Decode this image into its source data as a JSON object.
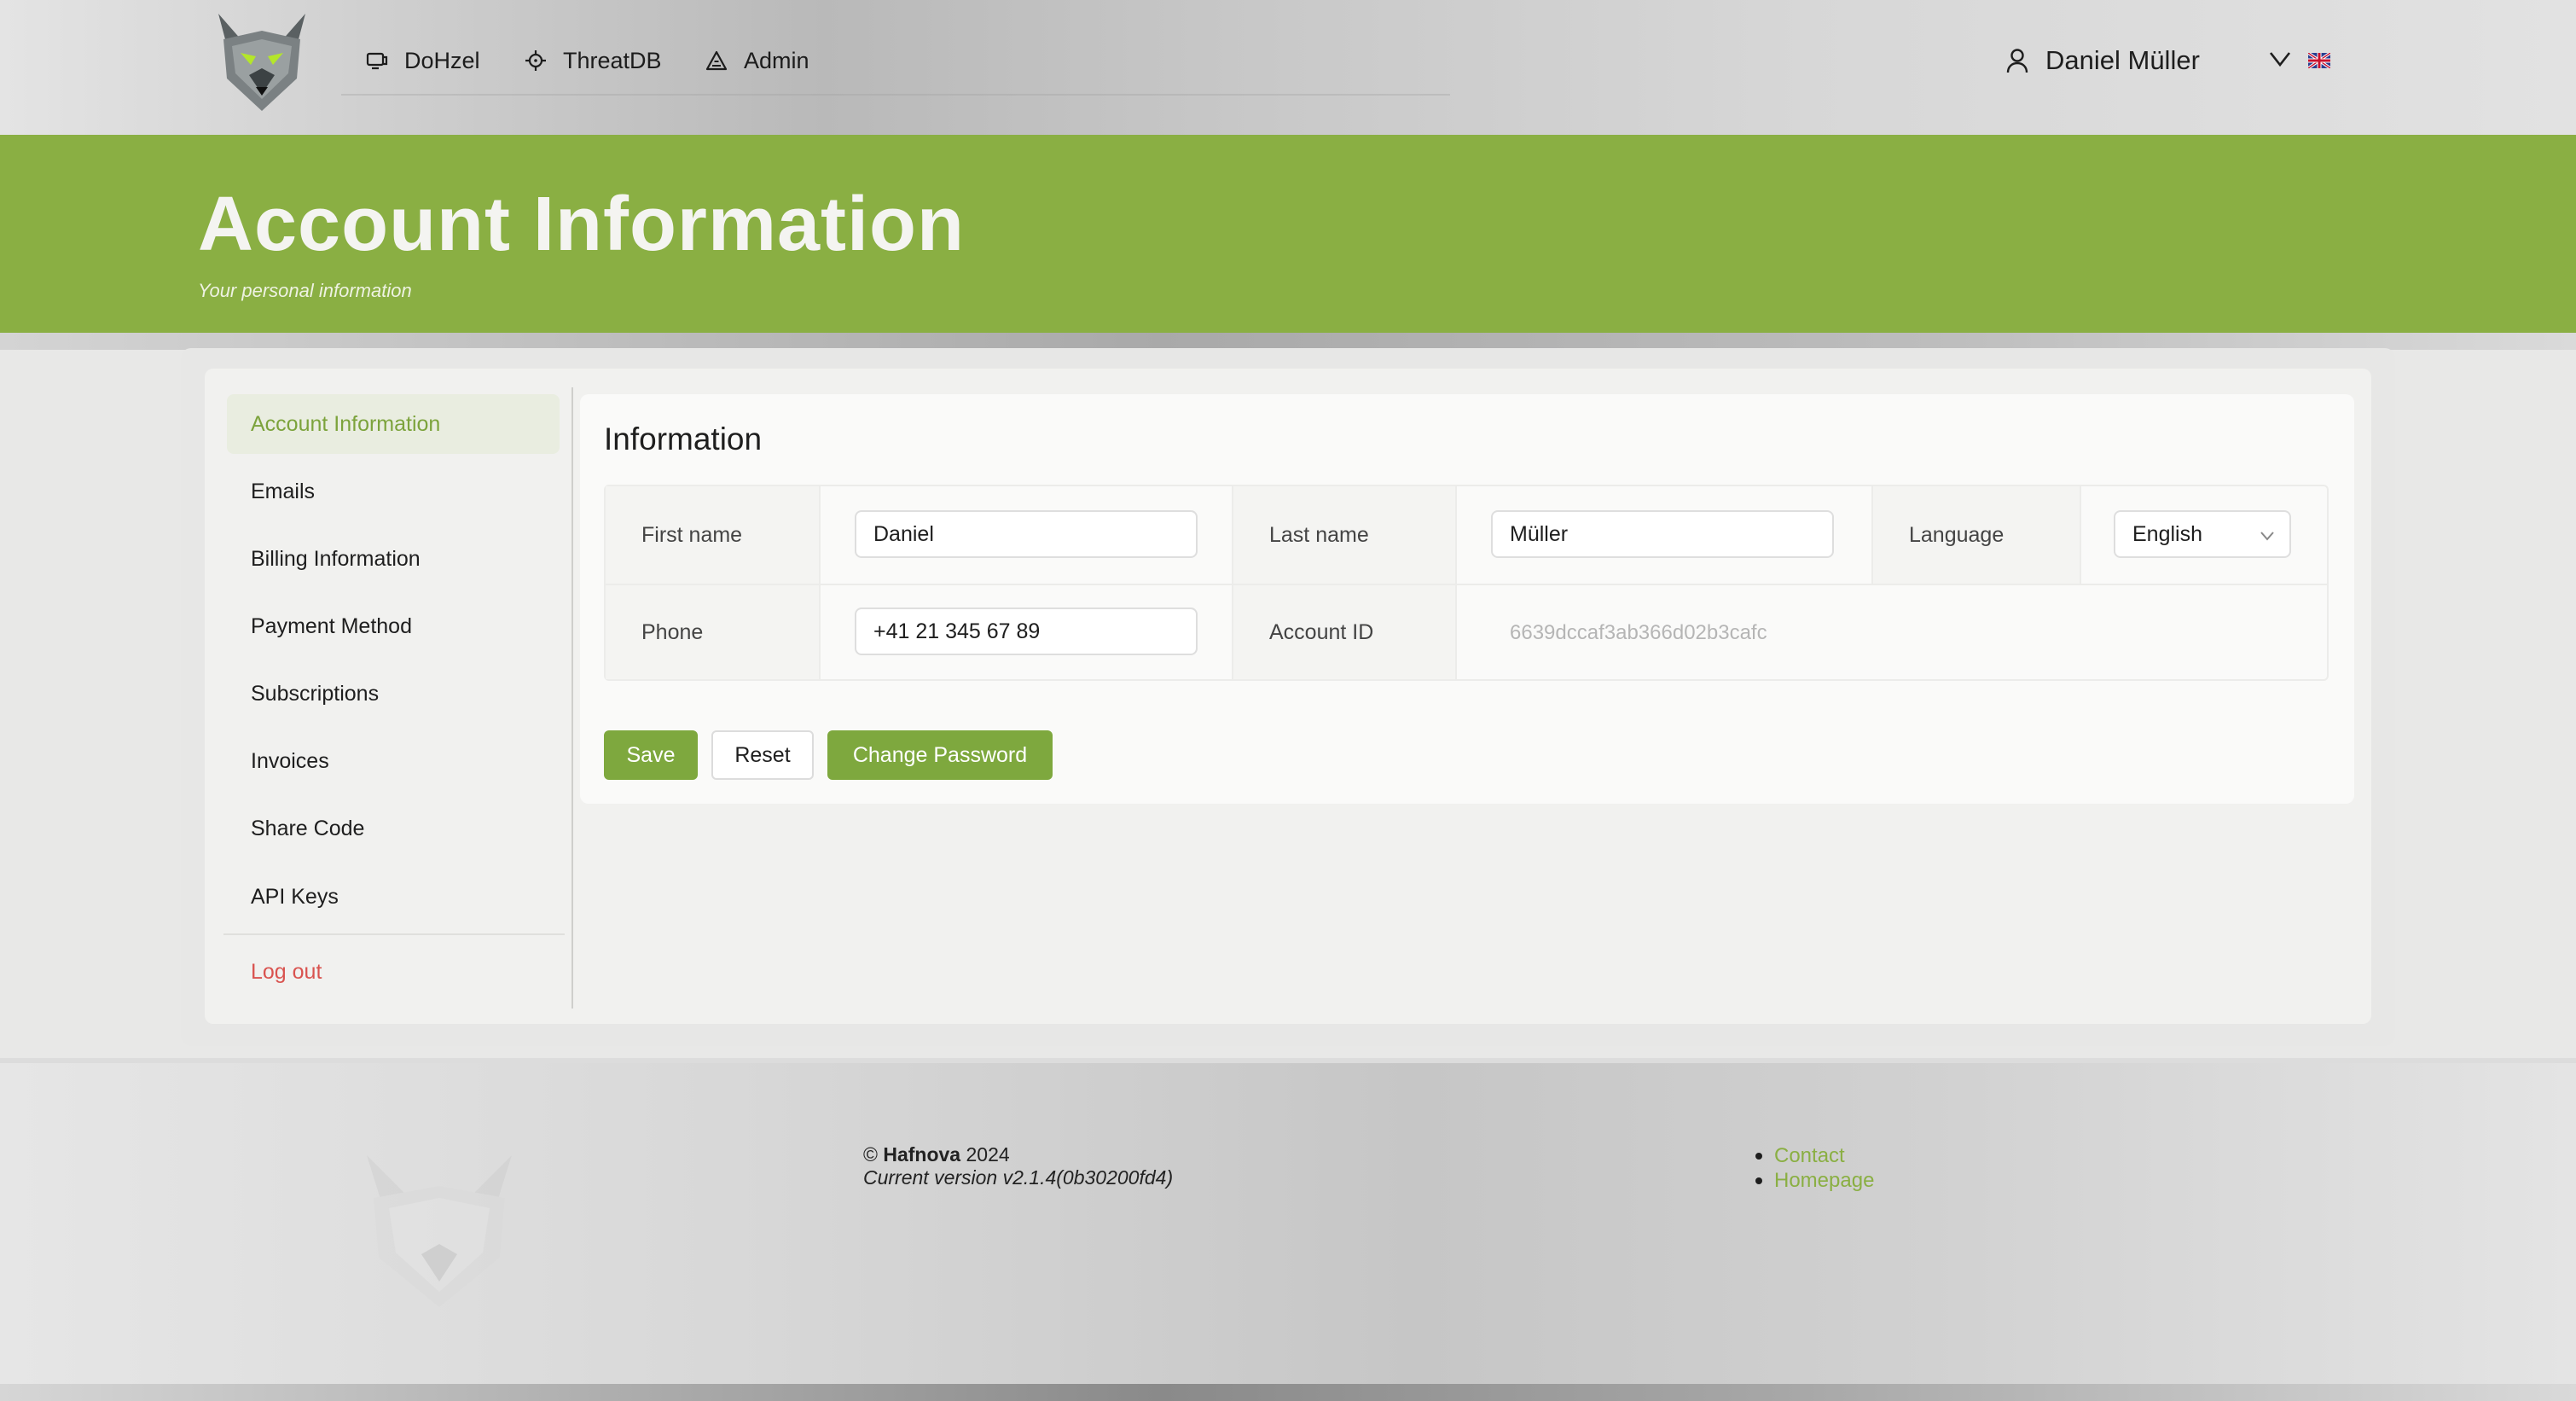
{
  "nav": {
    "items": [
      {
        "label": "DoHzel",
        "icon": "monitor-icon"
      },
      {
        "label": "ThreatDB",
        "icon": "crosshair-icon"
      },
      {
        "label": "Admin",
        "icon": "warning-triangle-icon"
      }
    ],
    "user_name": "Daniel Müller",
    "language_flag": "uk-flag-icon"
  },
  "hero": {
    "title": "Account Information",
    "subtitle": "Your personal information"
  },
  "sidebar": {
    "items": [
      {
        "label": "Account Information",
        "active": true
      },
      {
        "label": "Emails"
      },
      {
        "label": "Billing Information"
      },
      {
        "label": "Payment Method"
      },
      {
        "label": "Subscriptions"
      },
      {
        "label": "Invoices"
      },
      {
        "label": "Share Code"
      },
      {
        "label": "API Keys"
      }
    ],
    "logout_label": "Log out"
  },
  "info": {
    "title": "Information",
    "first_name_label": "First name",
    "first_name_value": "Daniel",
    "last_name_label": "Last name",
    "last_name_value": "Müller",
    "language_label": "Language",
    "language_value": "English",
    "phone_label": "Phone",
    "phone_value": "+41 21 345 67 89",
    "account_id_label": "Account ID",
    "account_id_value": "6639dccaf3ab366d02b3cafc"
  },
  "actions": {
    "save_label": "Save",
    "reset_label": "Reset",
    "change_password_label": "Change Password"
  },
  "footer": {
    "copyright_symbol": "©",
    "company": "Hafnova",
    "year": "2024",
    "version": "Current version v2.1.4(0b30200fd4)",
    "links": [
      "Contact",
      "Homepage"
    ]
  },
  "colors": {
    "brand_green": "#8aaf43",
    "button_green": "#7ea83e",
    "logout_red": "#d9534f"
  }
}
